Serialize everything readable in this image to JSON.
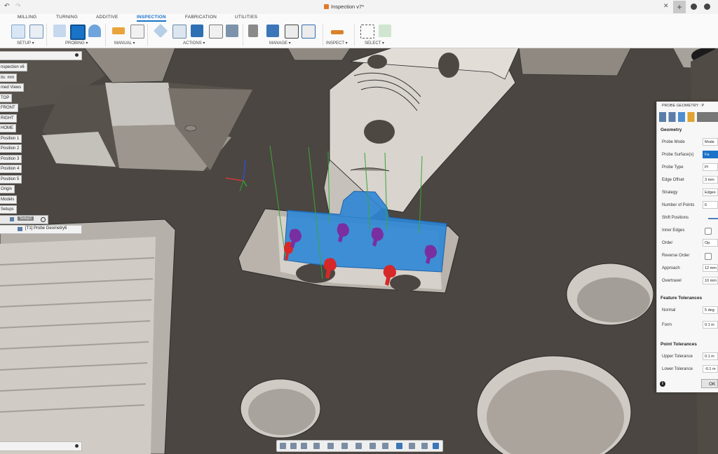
{
  "window": {
    "title": "Inspection v7*",
    "brand_color": "#1a73c7"
  },
  "tabs": [
    {
      "label": "MILLING"
    },
    {
      "label": "TURNING"
    },
    {
      "label": "ADDITIVE"
    },
    {
      "label": "INSPECTION"
    },
    {
      "label": "FABRICATION"
    },
    {
      "label": "UTILITIES"
    }
  ],
  "groups": {
    "setup": "SETUP ▾",
    "probing": "PROBING ▾",
    "manual": "MANUAL ▾",
    "actions": "ACTIONS ▾",
    "manage": "MANAGE ▾",
    "inspect": "INSPECT ▾",
    "select": "SELECT ▾"
  },
  "browser": {
    "items": [
      "nspection v6",
      "its: mm",
      "med Views",
      "TOP",
      "FRONT",
      "RIGHT",
      "HOME",
      "Position 1",
      "Position 2",
      "Position 3",
      "Position 4",
      "Position 5",
      "Origin",
      "Models",
      "Setups"
    ],
    "setup_label": "Setup1",
    "probe_item": "[T1] Probe Geometry6"
  },
  "panel": {
    "title": "PROBE GEOMETRY : P",
    "geometry": "Geometry",
    "rows": [
      {
        "label": "Probe Mode",
        "value": "Mode"
      },
      {
        "label": "Probe Surface(s)",
        "value": "Fa"
      },
      {
        "label": "Probe Type",
        "value": "Pl"
      },
      {
        "label": "Edge Offset",
        "value": "3 mm"
      },
      {
        "label": "Strategy",
        "value": "Edges"
      },
      {
        "label": "Number of Points",
        "value": "6"
      },
      {
        "label": "Shift Positions",
        "value": ""
      },
      {
        "label": "Inner Edges",
        "value": ""
      },
      {
        "label": "Order",
        "value": "Op"
      },
      {
        "label": "Reverse Order",
        "value": ""
      },
      {
        "label": "Approach",
        "value": "12 mm"
      },
      {
        "label": "Overtravel",
        "value": "10 mm"
      }
    ],
    "feature_tol": "Feature Tolerances",
    "tol_rows": [
      {
        "label": "Normal",
        "value": "5 deg"
      },
      {
        "label": "Form",
        "value": "0.1 m"
      }
    ],
    "point_tol": "Point Tolerances",
    "pt_rows": [
      {
        "label": "Upper Tolerance",
        "value": "0.1 m"
      },
      {
        "label": "Lower Tolerance",
        "value": "-0.1 m"
      }
    ],
    "ok": "OK"
  }
}
